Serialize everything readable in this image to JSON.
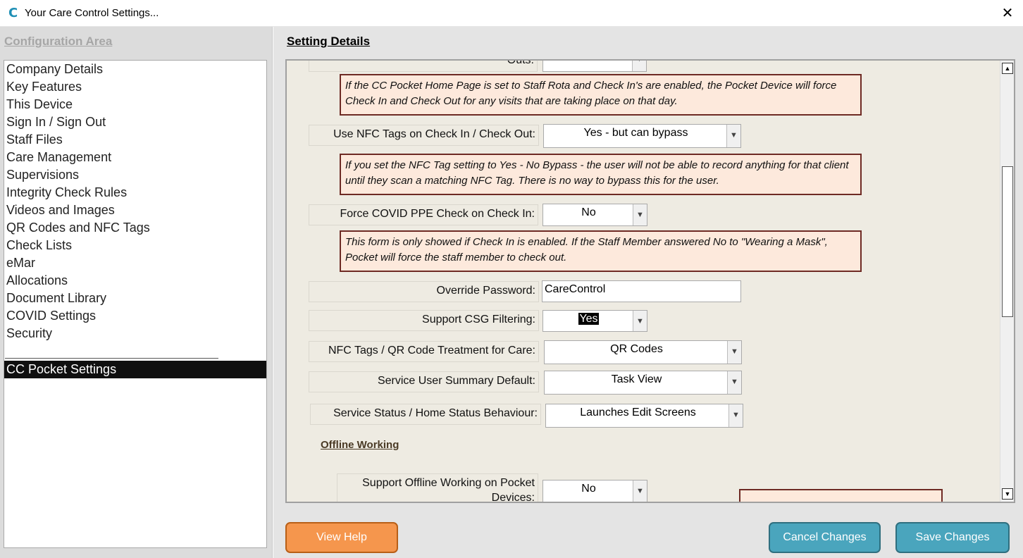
{
  "window": {
    "title": "Your Care Control Settings...",
    "icon": "care-control-logo-icon",
    "close_icon": "close-icon"
  },
  "sidebar": {
    "header": "Configuration Area",
    "items": [
      "Company Details",
      "Key Features",
      "This Device",
      "Sign In / Sign Out",
      "Staff Files",
      "Care Management",
      "Supervisions",
      "Integrity Check Rules",
      "Videos and Images",
      "QR Codes and NFC Tags",
      "Check Lists",
      "eMar",
      "Allocations",
      "Document Library",
      "COVID Settings",
      "Security"
    ],
    "selected": "CC Pocket Settings"
  },
  "details": {
    "header": "Setting Details",
    "partial_label": "Outs:",
    "notes": [
      "If the CC Pocket Home Page is set to Staff Rota and Check In's are enabled, the Pocket Device will force Check In and Check Out for any visits that are taking place on that day.",
      "If you set the NFC Tag setting to Yes - No Bypass - the user will not be able to record anything for that client until they scan a matching NFC Tag.  There is no way to bypass this for the user.",
      "This form is only showed if Check In is enabled.  If the Staff Member answered No to \"Wearing a Mask\", Pocket will force the staff member to check out."
    ],
    "settings": {
      "nfc_checkin": {
        "label": "Use NFC Tags on Check In / Check Out:",
        "value": "Yes - but can bypass"
      },
      "covid_ppe": {
        "label": "Force COVID PPE Check on Check In:",
        "value": "No"
      },
      "override_password": {
        "label": "Override Password:",
        "value": "CareControl"
      },
      "csg_filtering": {
        "label": "Support CSG Filtering:",
        "value": "Yes"
      },
      "nfc_qr_treatment": {
        "label": "NFC Tags / QR Code Treatment for Care:",
        "value": "QR Codes"
      },
      "summary_default": {
        "label": "Service User Summary Default:",
        "value": "Task View"
      },
      "status_behaviour": {
        "label": "Service Status / Home Status Behaviour:",
        "value": "Launches Edit Screens"
      },
      "offline_working": {
        "label": "Support Offline Working on Pocket Devices:",
        "value": "No"
      }
    },
    "offline_section_title": "Offline Working"
  },
  "buttons": {
    "help": "View Help",
    "cancel": "Cancel Changes",
    "save": "Save Changes"
  }
}
